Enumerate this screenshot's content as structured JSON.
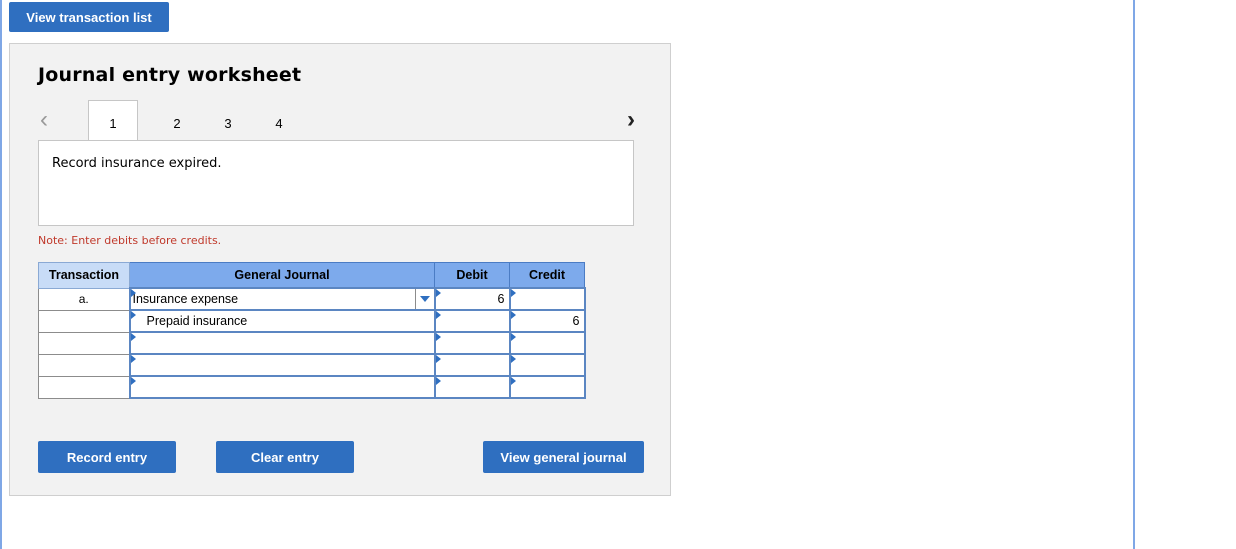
{
  "top_button": "View transaction list",
  "worksheet": {
    "title": "Journal entry worksheet",
    "tabs": [
      "1",
      "2",
      "3",
      "4"
    ],
    "active_tab": "1",
    "description": "Record insurance expired.",
    "note": "Note: Enter debits before credits."
  },
  "journal": {
    "headers": {
      "transaction": "Transaction",
      "general_journal": "General Journal",
      "debit": "Debit",
      "credit": "Credit"
    },
    "rows": [
      {
        "transaction": "a.",
        "account": "Insurance expense",
        "debit": "6",
        "credit": ""
      },
      {
        "transaction": "",
        "account": "Prepaid insurance",
        "debit": "",
        "credit": "6"
      },
      {
        "transaction": "",
        "account": "",
        "debit": "",
        "credit": ""
      },
      {
        "transaction": "",
        "account": "",
        "debit": "",
        "credit": ""
      },
      {
        "transaction": "",
        "account": "",
        "debit": "",
        "credit": ""
      }
    ]
  },
  "buttons": {
    "record": "Record entry",
    "clear": "Clear entry",
    "view_journal": "View general journal"
  },
  "icons": {
    "prev": "chevron-left-icon",
    "next": "chevron-right-icon",
    "dropdown": "dropdown-arrow-icon"
  },
  "colors": {
    "button": "#2f6fc0",
    "header": "#7daaec",
    "note": "#c0392b"
  }
}
